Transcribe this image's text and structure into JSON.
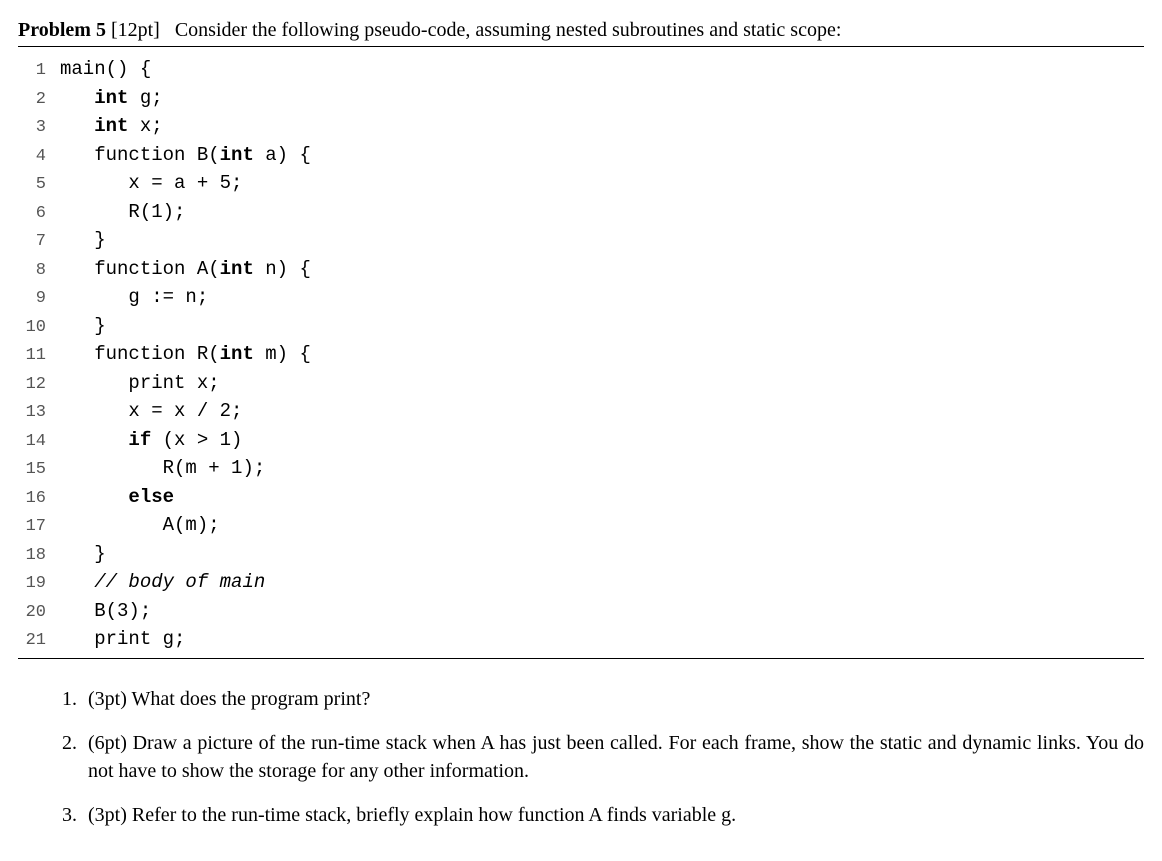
{
  "header": {
    "label": "Problem 5",
    "points": "[12pt]",
    "text": "Consider the following pseudo-code, assuming nested subroutines and static scope:"
  },
  "code": {
    "lines": [
      {
        "n": "1",
        "indent": 0,
        "tokens": [
          {
            "t": "main() {",
            "cls": ""
          }
        ]
      },
      {
        "n": "2",
        "indent": 1,
        "tokens": [
          {
            "t": "int",
            "cls": "kw"
          },
          {
            "t": " g;",
            "cls": ""
          }
        ]
      },
      {
        "n": "3",
        "indent": 1,
        "tokens": [
          {
            "t": "int",
            "cls": "kw"
          },
          {
            "t": " x;",
            "cls": ""
          }
        ]
      },
      {
        "n": "4",
        "indent": 1,
        "tokens": [
          {
            "t": "function B(",
            "cls": ""
          },
          {
            "t": "int",
            "cls": "kw"
          },
          {
            "t": " a) {",
            "cls": ""
          }
        ]
      },
      {
        "n": "5",
        "indent": 2,
        "tokens": [
          {
            "t": "x = a + 5;",
            "cls": ""
          }
        ]
      },
      {
        "n": "6",
        "indent": 2,
        "tokens": [
          {
            "t": "R(1);",
            "cls": ""
          }
        ]
      },
      {
        "n": "7",
        "indent": 1,
        "tokens": [
          {
            "t": "}",
            "cls": ""
          }
        ]
      },
      {
        "n": "8",
        "indent": 1,
        "tokens": [
          {
            "t": "function A(",
            "cls": ""
          },
          {
            "t": "int",
            "cls": "kw"
          },
          {
            "t": " n) {",
            "cls": ""
          }
        ]
      },
      {
        "n": "9",
        "indent": 2,
        "tokens": [
          {
            "t": "g := n;",
            "cls": ""
          }
        ]
      },
      {
        "n": "10",
        "indent": 1,
        "tokens": [
          {
            "t": "}",
            "cls": ""
          }
        ]
      },
      {
        "n": "11",
        "indent": 1,
        "tokens": [
          {
            "t": "function R(",
            "cls": ""
          },
          {
            "t": "int",
            "cls": "kw"
          },
          {
            "t": " m) {",
            "cls": ""
          }
        ]
      },
      {
        "n": "12",
        "indent": 2,
        "tokens": [
          {
            "t": "print x;",
            "cls": ""
          }
        ]
      },
      {
        "n": "13",
        "indent": 2,
        "tokens": [
          {
            "t": "x = x / 2;",
            "cls": ""
          }
        ]
      },
      {
        "n": "14",
        "indent": 2,
        "tokens": [
          {
            "t": "if",
            "cls": "kw"
          },
          {
            "t": " (x > 1)",
            "cls": ""
          }
        ]
      },
      {
        "n": "15",
        "indent": 3,
        "tokens": [
          {
            "t": "R(m + 1);",
            "cls": ""
          }
        ]
      },
      {
        "n": "16",
        "indent": 2,
        "tokens": [
          {
            "t": "else",
            "cls": "kw"
          }
        ]
      },
      {
        "n": "17",
        "indent": 3,
        "tokens": [
          {
            "t": "A(m);",
            "cls": ""
          }
        ]
      },
      {
        "n": "18",
        "indent": 1,
        "tokens": [
          {
            "t": "}",
            "cls": ""
          }
        ]
      },
      {
        "n": "19",
        "indent": 1,
        "tokens": [
          {
            "t": "// body of main",
            "cls": "comment"
          }
        ]
      },
      {
        "n": "20",
        "indent": 1,
        "tokens": [
          {
            "t": "B(3);",
            "cls": ""
          }
        ]
      },
      {
        "n": "21",
        "indent": 1,
        "tokens": [
          {
            "t": "print g;",
            "cls": ""
          }
        ]
      }
    ],
    "indent_unit": "   "
  },
  "questions": [
    {
      "num": "1.",
      "body": "(3pt) What does the program print?"
    },
    {
      "num": "2.",
      "body": "(6pt) Draw a picture of the run-time stack when A has just been called. For each frame, show the static and dynamic links. You do not have to show the storage for any other information."
    },
    {
      "num": "3.",
      "body": "(3pt) Refer to the run-time stack, briefly explain how function A finds variable g."
    }
  ]
}
